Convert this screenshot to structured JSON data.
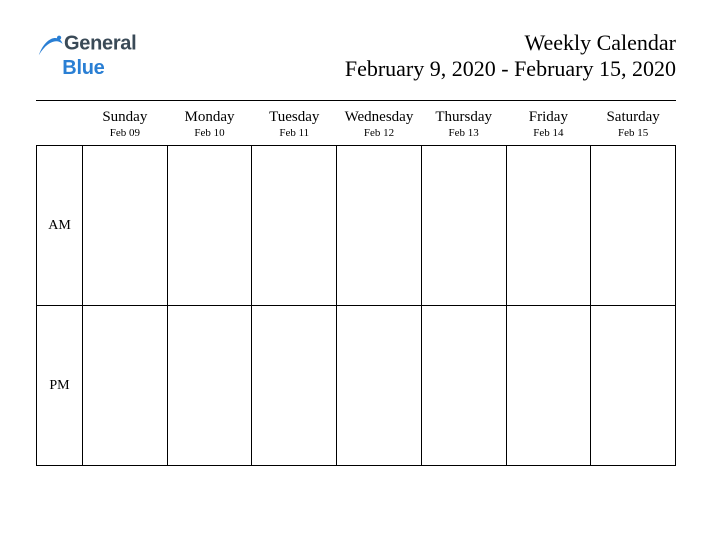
{
  "logo": {
    "text_general": "General",
    "text_blue": "Blue"
  },
  "header": {
    "title": "Weekly Calendar",
    "subtitle": "February 9, 2020 - February 15, 2020"
  },
  "days": [
    {
      "name": "Sunday",
      "date": "Feb 09"
    },
    {
      "name": "Monday",
      "date": "Feb 10"
    },
    {
      "name": "Tuesday",
      "date": "Feb 11"
    },
    {
      "name": "Wednesday",
      "date": "Feb 12"
    },
    {
      "name": "Thursday",
      "date": "Feb 13"
    },
    {
      "name": "Friday",
      "date": "Feb 14"
    },
    {
      "name": "Saturday",
      "date": "Feb 15"
    }
  ],
  "rows": {
    "am": "AM",
    "pm": "PM"
  }
}
